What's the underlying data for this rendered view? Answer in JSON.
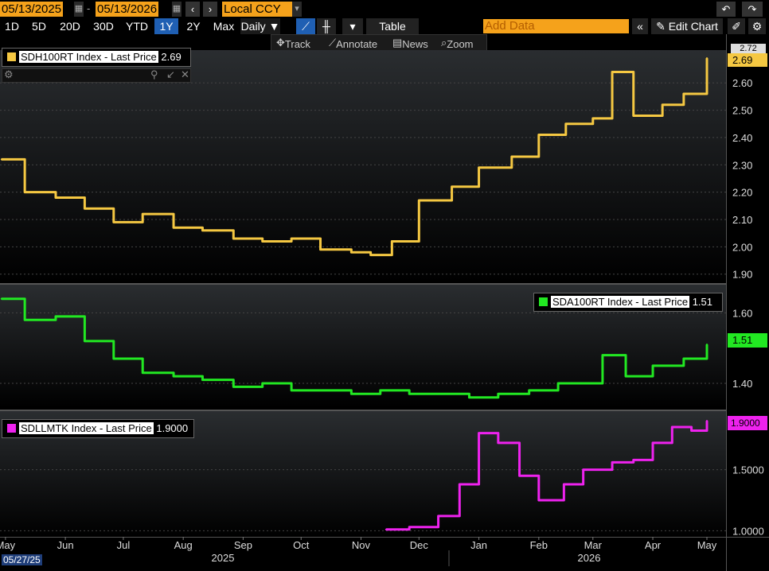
{
  "toolbar": {
    "start_date": "05/13/2025",
    "end_date": "05/13/2026",
    "currency": "Local CCY",
    "table_label": "Table",
    "add_data_placeholder": "Add Data",
    "edit_chart_label": "Edit Chart",
    "periods": [
      "1D",
      "5D",
      "20D",
      "30D",
      "YTD",
      "1Y",
      "2Y",
      "Max"
    ],
    "active_period": "1Y",
    "frequency": "Daily"
  },
  "subbar": {
    "track": "Track",
    "annotate": "Annotate",
    "news": "News",
    "zoom": "Zoom"
  },
  "panels": [
    {
      "legend": "SDH100RT Index - Last Price",
      "last_value": "2.69",
      "alt_value": "2.72",
      "color": "#f5c842",
      "yticks": [
        "2.60",
        "2.50",
        "2.40",
        "2.30",
        "2.20",
        "2.10",
        "2.00",
        "1.90"
      ]
    },
    {
      "legend": "SDA100RT Index - Last Price",
      "last_value": "1.51",
      "color": "#22e822",
      "yticks": [
        "1.60",
        "1.40"
      ]
    },
    {
      "legend": "SDLLMTK Index - Last Price",
      "last_value": "1.9000",
      "color": "#ee22ee",
      "yticks": [
        "1.5000",
        "1.0000"
      ]
    }
  ],
  "xaxis": {
    "months": [
      "May",
      "Jun",
      "Jul",
      "Aug",
      "Sep",
      "Oct",
      "Nov",
      "Dec",
      "Jan",
      "Feb",
      "Mar",
      "Apr",
      "May"
    ],
    "years": [
      "2025",
      "2026"
    ],
    "cursor_date": "05/27/25"
  },
  "chart_data": [
    {
      "type": "line",
      "title": "SDH100RT Index - Last Price",
      "ylim": [
        1.9,
        2.7
      ],
      "x": [
        "2025-05-13",
        "2025-05-25",
        "2025-06-10",
        "2025-06-25",
        "2025-07-10",
        "2025-07-25",
        "2025-08-10",
        "2025-08-25",
        "2025-09-10",
        "2025-09-25",
        "2025-10-10",
        "2025-10-25",
        "2025-11-10",
        "2025-11-20",
        "2025-12-01",
        "2025-12-15",
        "2026-01-01",
        "2026-01-15",
        "2026-02-01",
        "2026-02-15",
        "2026-03-01",
        "2026-03-15",
        "2026-03-25",
        "2026-04-05",
        "2026-04-20",
        "2026-05-01",
        "2026-05-13"
      ],
      "series": [
        {
          "name": "SDH100RT Index - Last Price",
          "values": [
            2.32,
            2.2,
            2.18,
            2.14,
            2.09,
            2.12,
            2.07,
            2.06,
            2.03,
            2.02,
            2.03,
            1.99,
            1.98,
            1.97,
            2.02,
            2.17,
            2.22,
            2.29,
            2.33,
            2.41,
            2.45,
            2.47,
            2.64,
            2.48,
            2.52,
            2.56,
            2.69
          ]
        }
      ]
    },
    {
      "type": "line",
      "title": "SDA100RT Index - Last Price",
      "ylim": [
        1.35,
        1.68
      ],
      "x": [
        "2025-05-13",
        "2025-05-25",
        "2025-06-10",
        "2025-06-25",
        "2025-07-10",
        "2025-07-25",
        "2025-08-10",
        "2025-08-25",
        "2025-09-10",
        "2025-09-25",
        "2025-10-10",
        "2025-10-25",
        "2025-11-10",
        "2025-11-25",
        "2025-12-10",
        "2025-12-25",
        "2026-01-10",
        "2026-01-25",
        "2026-02-10",
        "2026-02-25",
        "2026-03-10",
        "2026-03-20",
        "2026-04-01",
        "2026-04-15",
        "2026-05-01",
        "2026-05-13"
      ],
      "series": [
        {
          "name": "SDA100RT Index - Last Price",
          "values": [
            1.64,
            1.58,
            1.59,
            1.52,
            1.47,
            1.43,
            1.42,
            1.41,
            1.39,
            1.4,
            1.38,
            1.38,
            1.37,
            1.38,
            1.37,
            1.37,
            1.36,
            1.37,
            1.38,
            1.4,
            1.4,
            1.48,
            1.42,
            1.45,
            1.47,
            1.51
          ]
        }
      ]
    },
    {
      "type": "line",
      "title": "SDLLMTK Index - Last Price",
      "ylim": [
        0.95,
        1.95
      ],
      "x": [
        "2025-11-28",
        "2025-12-10",
        "2025-12-25",
        "2026-01-05",
        "2026-01-15",
        "2026-01-25",
        "2026-02-05",
        "2026-02-15",
        "2026-02-28",
        "2026-03-10",
        "2026-03-25",
        "2026-04-05",
        "2026-04-15",
        "2026-04-25",
        "2026-05-05",
        "2026-05-13"
      ],
      "series": [
        {
          "name": "SDLLMTK Index - Last Price",
          "values": [
            1.01,
            1.03,
            1.12,
            1.38,
            1.8,
            1.72,
            1.45,
            1.25,
            1.38,
            1.5,
            1.56,
            1.58,
            1.72,
            1.85,
            1.82,
            1.9
          ]
        }
      ]
    }
  ]
}
